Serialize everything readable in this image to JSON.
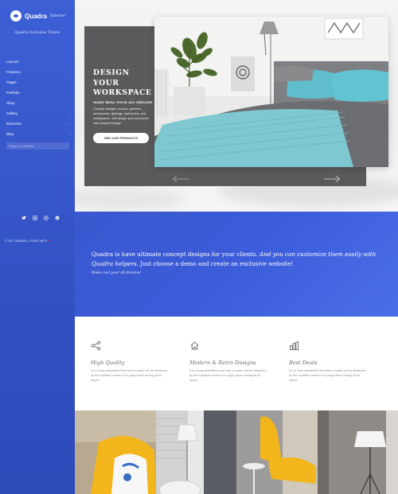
{
  "brand": {
    "name": "Quadra",
    "suffix": "Interior",
    "tagline": "Quadra Exclusive Theme"
  },
  "menu": [
    {
      "label": "Layouts",
      "has_sub": false
    },
    {
      "label": "Features",
      "has_sub": true
    },
    {
      "label": "Pages",
      "has_sub": true
    },
    {
      "label": "Portfolio",
      "has_sub": true
    },
    {
      "label": "Shop",
      "has_sub": true
    },
    {
      "label": "Gallery",
      "has_sub": true
    },
    {
      "label": "Elements",
      "has_sub": true
    },
    {
      "label": "Blog",
      "has_sub": true
    }
  ],
  "search": {
    "placeholder": "Search on website...",
    "value": ""
  },
  "socials": [
    "twitter-icon",
    "instagram-icon",
    "dribbble-icon",
    "skype-icon"
  ],
  "copyright": {
    "text": "© 2017 QUADRA, CODED WITH",
    "heart": "♥"
  },
  "hero": {
    "title": "DESIGN YOUR WORKSPACE",
    "subtitle": "MAKE REAL YOUR ALL DREAMS",
    "description": "Concept designs, houses, gardens, accessories, lightings, bathrooms, and workspaces. Just design your new world with Quadra Design!",
    "button": "SEE OUR PRODUCTS"
  },
  "intro": {
    "text_a": "Quadra is have ultimate concept designs for your clients.",
    "text_b": "And you can customize them easily with Quadra helpers.",
    "text_c": "Just choose a demo and create an exclusive website!",
    "note": "Make real your all dreams!"
  },
  "features": [
    {
      "icon": "share-icon",
      "title": "High Quality",
      "text": "It is a long established fact that a reader will be distracted by the readable content of a page when looking at its layout."
    },
    {
      "icon": "home-icon",
      "title": "Modern & Retro Designs",
      "text": "It is a long established fact that a reader will be distracted by the readable content of a page when looking at its layout."
    },
    {
      "icon": "bar-chart-icon",
      "title": "Best Deals",
      "text": "It is a long established fact that a reader will be distracted by the readable content of a page when looking at its layout."
    }
  ],
  "colors": {
    "brand_blue": "#3d5fd6",
    "hero_dark": "#5a5a5c",
    "heart": "#e5394b",
    "accent_yellow": "#f3b51c"
  }
}
